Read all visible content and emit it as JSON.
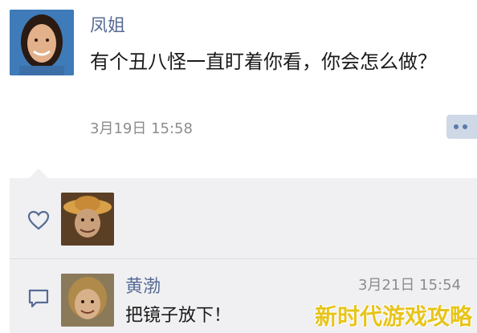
{
  "post": {
    "author": "凤姐",
    "content": "有个丑八怪一直盯着你看，你会怎么做？",
    "time": "3月19日 15:58",
    "avatar_icon": "person-photo-avatar"
  },
  "feedback": {
    "like_icon": "heart-icon",
    "comment_icon": "comment-icon",
    "liker_avatar": "person-with-hat-avatar",
    "comment": {
      "author": "黄渤",
      "time": "3月21日 15:54",
      "text": "把镜子放下！",
      "avatar_icon": "person-photo-avatar"
    }
  },
  "watermark": "新时代游戏攻略",
  "colors": {
    "name_link": "#576b95",
    "timestamp": "#8c8c8c",
    "feedback_bg": "#f0f0f2",
    "watermark": "#e8c41a"
  }
}
